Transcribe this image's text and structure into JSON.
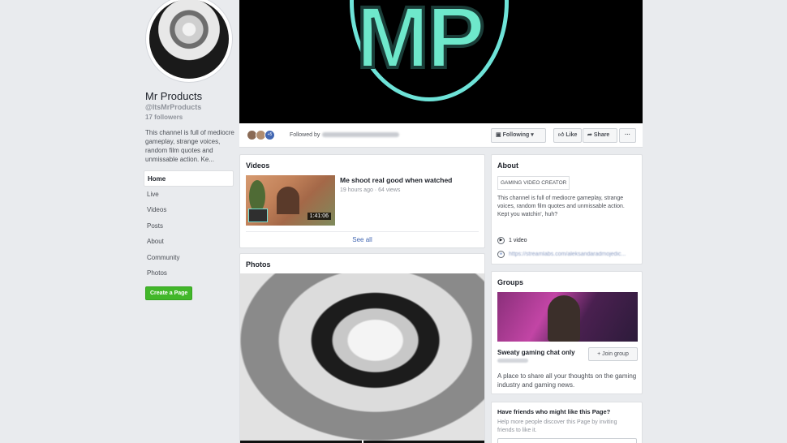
{
  "profile": {
    "name": "Mr Products",
    "handle": "@ItsMrProducts",
    "followers": "17 followers",
    "description": "This channel is full of mediocre gameplay, strange voices, random film quotes and unmissable action. Ke..."
  },
  "sidebar": {
    "items": [
      {
        "label": "Home",
        "active": true
      },
      {
        "label": "Live"
      },
      {
        "label": "Videos"
      },
      {
        "label": "Posts"
      },
      {
        "label": "About"
      },
      {
        "label": "Community"
      },
      {
        "label": "Photos"
      }
    ],
    "create_page": "Create a Page"
  },
  "cover": {
    "logo_text": "MP",
    "logo_color": "#6ee8cb"
  },
  "action_bar": {
    "follower_badge": "+5",
    "followed_by": "Followed by",
    "following_label": "Following",
    "like_label": "Like",
    "share_label": "Share",
    "more_label": "···"
  },
  "videos": {
    "title": "Videos",
    "items": [
      {
        "title": "Me shoot real good when watched",
        "meta": "19 hours ago · 64 views",
        "duration": "1:41:06"
      }
    ],
    "see_all": "See all"
  },
  "photos": {
    "title": "Photos"
  },
  "about": {
    "title": "About",
    "category": "GAMING VIDEO CREATOR",
    "description": "This channel is full of mediocre gameplay, strange voices, random film quotes and unmissable action. Kept you watchin', huh?",
    "videos_count": "1 video",
    "link": "https://streamlabs.com/aleksandaradmojedic..."
  },
  "groups": {
    "title": "Groups",
    "name": "Sweaty gaming chat only",
    "join_label": "+ Join group",
    "description": "A place to share all your thoughts on the gaming industry and gaming news."
  },
  "invite": {
    "title": "Have friends who might like this Page?",
    "description": "Help more people discover this Page by inviting friends to like it."
  },
  "colors": {
    "accent": "#4267b2",
    "create_button": "#42b72a",
    "background": "#e9ebee"
  }
}
